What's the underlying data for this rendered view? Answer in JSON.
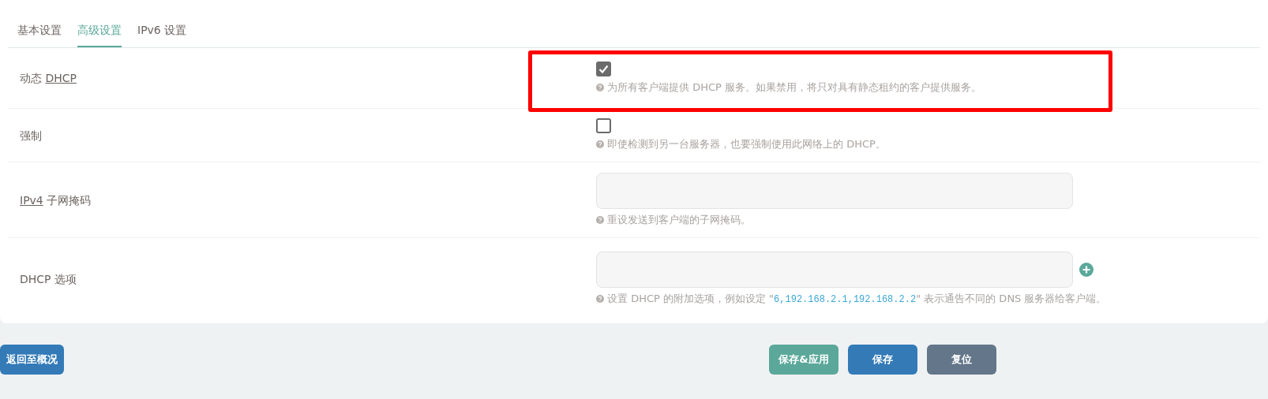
{
  "tabs": [
    {
      "label": "基本设置",
      "selected": false
    },
    {
      "label": "高级设置",
      "selected": true
    },
    {
      "label": "IPv6 设置",
      "selected": false
    }
  ],
  "rows": [
    {
      "kind": "checkbox",
      "highlighted": true,
      "label": [
        {
          "text": "动态 ",
          "abbr": false
        },
        {
          "text": "DHCP",
          "abbr": true
        }
      ],
      "checked": true,
      "hint": [
        {
          "text": "为所有客户端提供 DHCP 服务。如果禁用，将只对具有静态租约的客户提供服务。",
          "code": false
        }
      ]
    },
    {
      "kind": "checkbox",
      "highlighted": false,
      "label": [
        {
          "text": "强制",
          "abbr": false
        }
      ],
      "checked": false,
      "hint": [
        {
          "text": "即使检测到另一台服务器，也要强制使用此网络上的 DHCP。",
          "code": false
        }
      ]
    },
    {
      "kind": "input",
      "highlighted": false,
      "label": [
        {
          "text": "IPv4",
          "abbr": true
        },
        {
          "text": " 子网掩码",
          "abbr": false
        }
      ],
      "hint": [
        {
          "text": "重设发送到客户端的子网掩码。",
          "code": false
        }
      ]
    },
    {
      "kind": "input-add",
      "highlighted": false,
      "label": [
        {
          "text": "DHCP 选项",
          "abbr": false
        }
      ],
      "hint": [
        {
          "text": "设置 DHCP 的附加选项，例如设定 \"",
          "code": false
        },
        {
          "text": "6,192.168.2.1,192.168.2.2",
          "code": true
        },
        {
          "text": "\" 表示通告不同的 DNS 服务器给客户端。",
          "code": false
        }
      ]
    }
  ],
  "back_button": "返回至概况",
  "actions": [
    {
      "label": "保存&应用",
      "color": "#5ba89a"
    },
    {
      "label": "保存",
      "color": "#337ab7"
    },
    {
      "label": "复位",
      "color": "#64768a"
    }
  ]
}
